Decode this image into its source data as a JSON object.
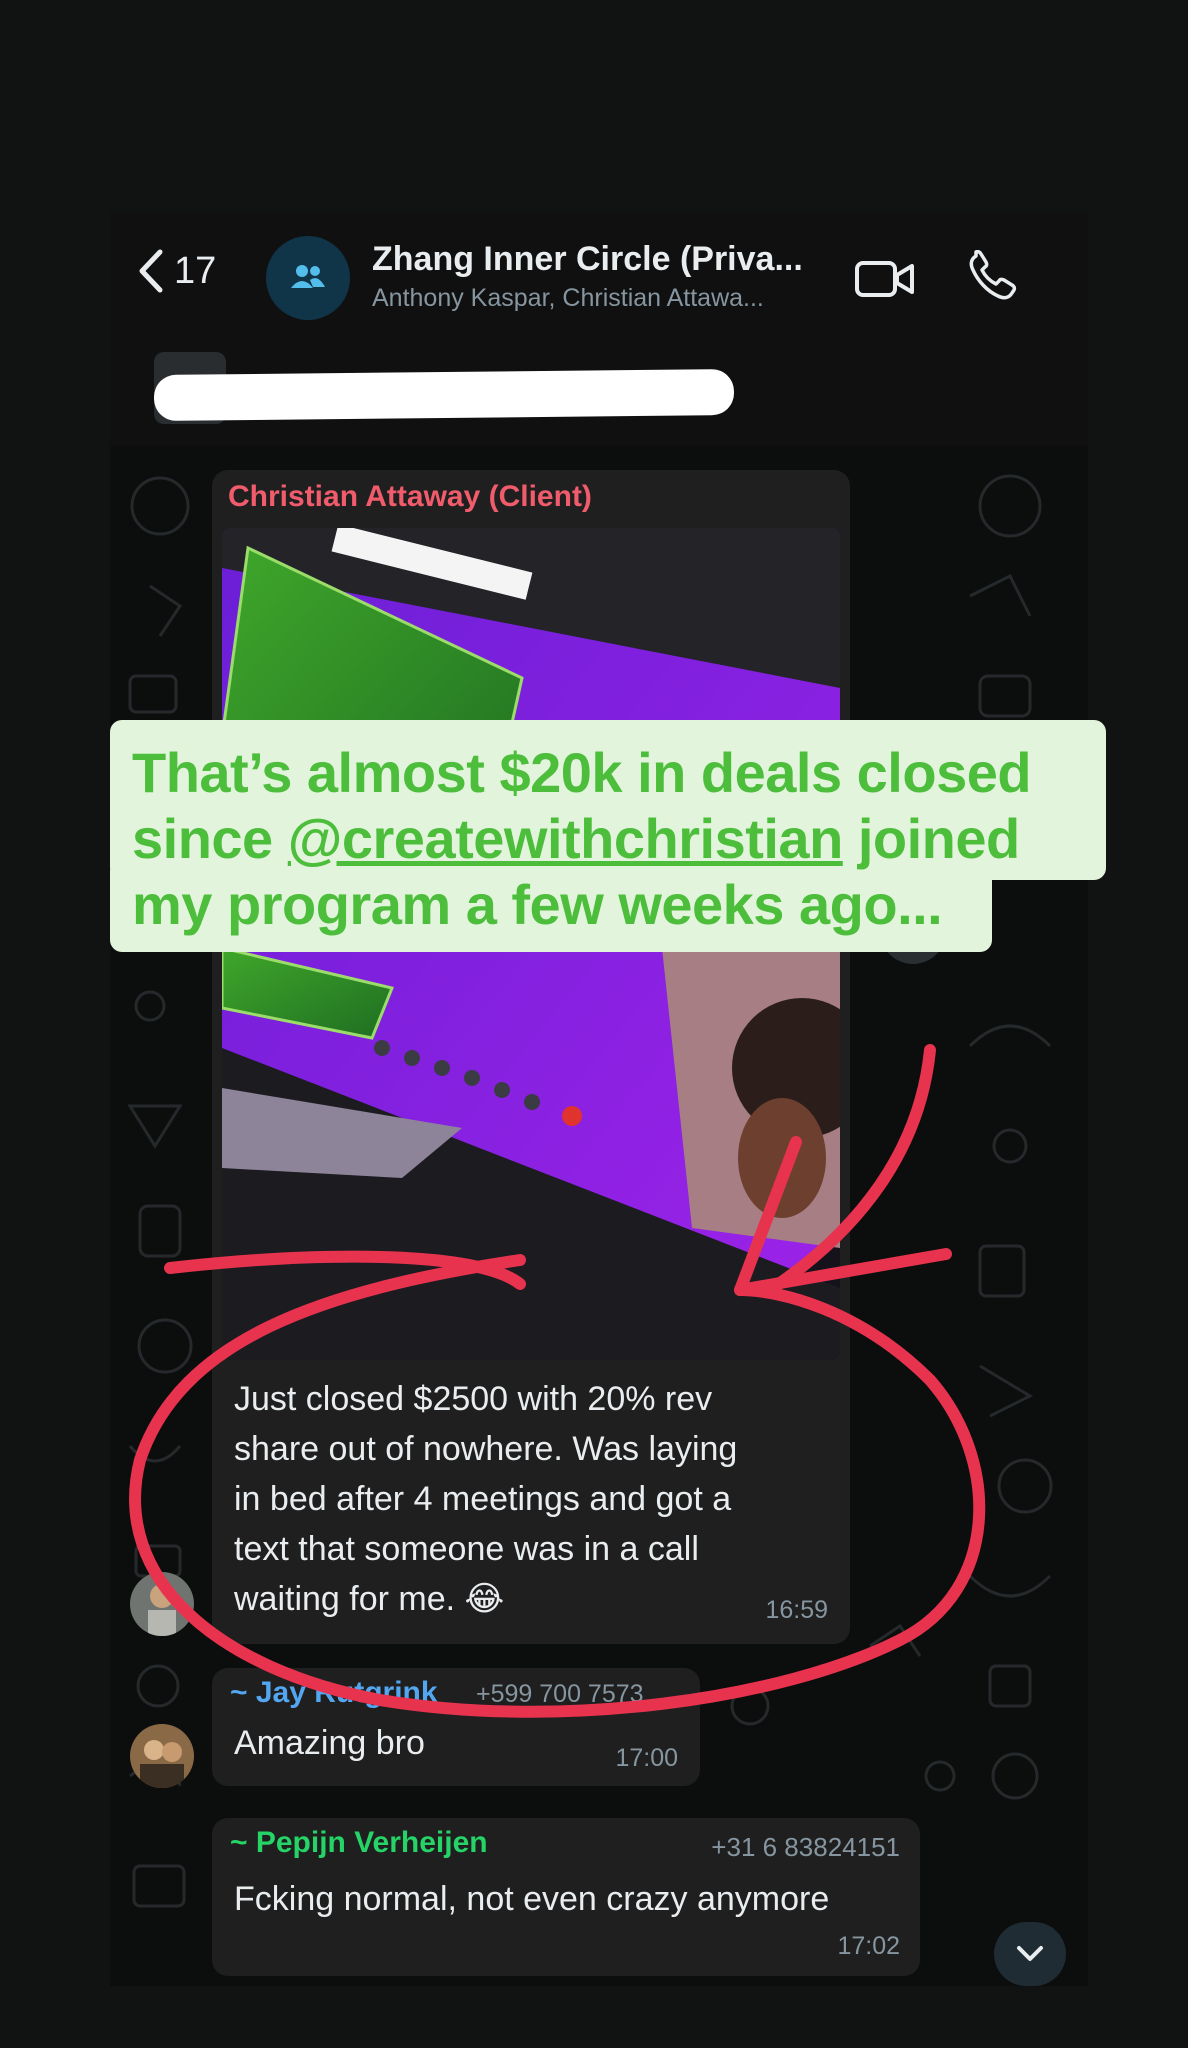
{
  "header": {
    "back_count": "17",
    "group_title": "Zhang Inner Circle (Priva...",
    "members": "Anthony Kaspar, Christian Attawa...",
    "icons": {
      "back": "chevron-left-icon",
      "avatar": "group-icon",
      "video": "video-camera-icon",
      "call": "phone-icon"
    }
  },
  "messages": [
    {
      "sender": "Christian Attaway (Client)",
      "sender_color": "#f15c6d",
      "has_photo": true,
      "text_lines": [
        "Just closed $2500 with 20% rev",
        "share out of nowhere. Was laying",
        "in bed after 4 meetings and got a",
        "text that someone was in a call",
        "waiting for me. 😂"
      ],
      "time": "16:59"
    },
    {
      "sender": "~ Jay Rutgrink",
      "sender_color": "#53a6f0",
      "phone": "+599 700 7573",
      "text": "Amazing bro",
      "time": "17:00"
    },
    {
      "sender": "~ Pepijn Verheijen",
      "sender_color": "#25d366",
      "phone": "+31 6 83824151",
      "text": "Fcking normal, not even crazy anymore",
      "time": "17:02"
    }
  ],
  "overlay": {
    "line1": "That’s almost $20k in deals closed",
    "line2_prefix": "since ",
    "mention": "@createwithchristian",
    "line2_suffix": " joined",
    "line3": "my program a few weeks ago...",
    "text_color": "#4dbd3c",
    "bg_color": "#e2f5dc"
  },
  "annotation_color": "#e8334f",
  "colors": {
    "chat_bg": "#0c0d0d",
    "bubble_bg": "#1f1f1f"
  }
}
